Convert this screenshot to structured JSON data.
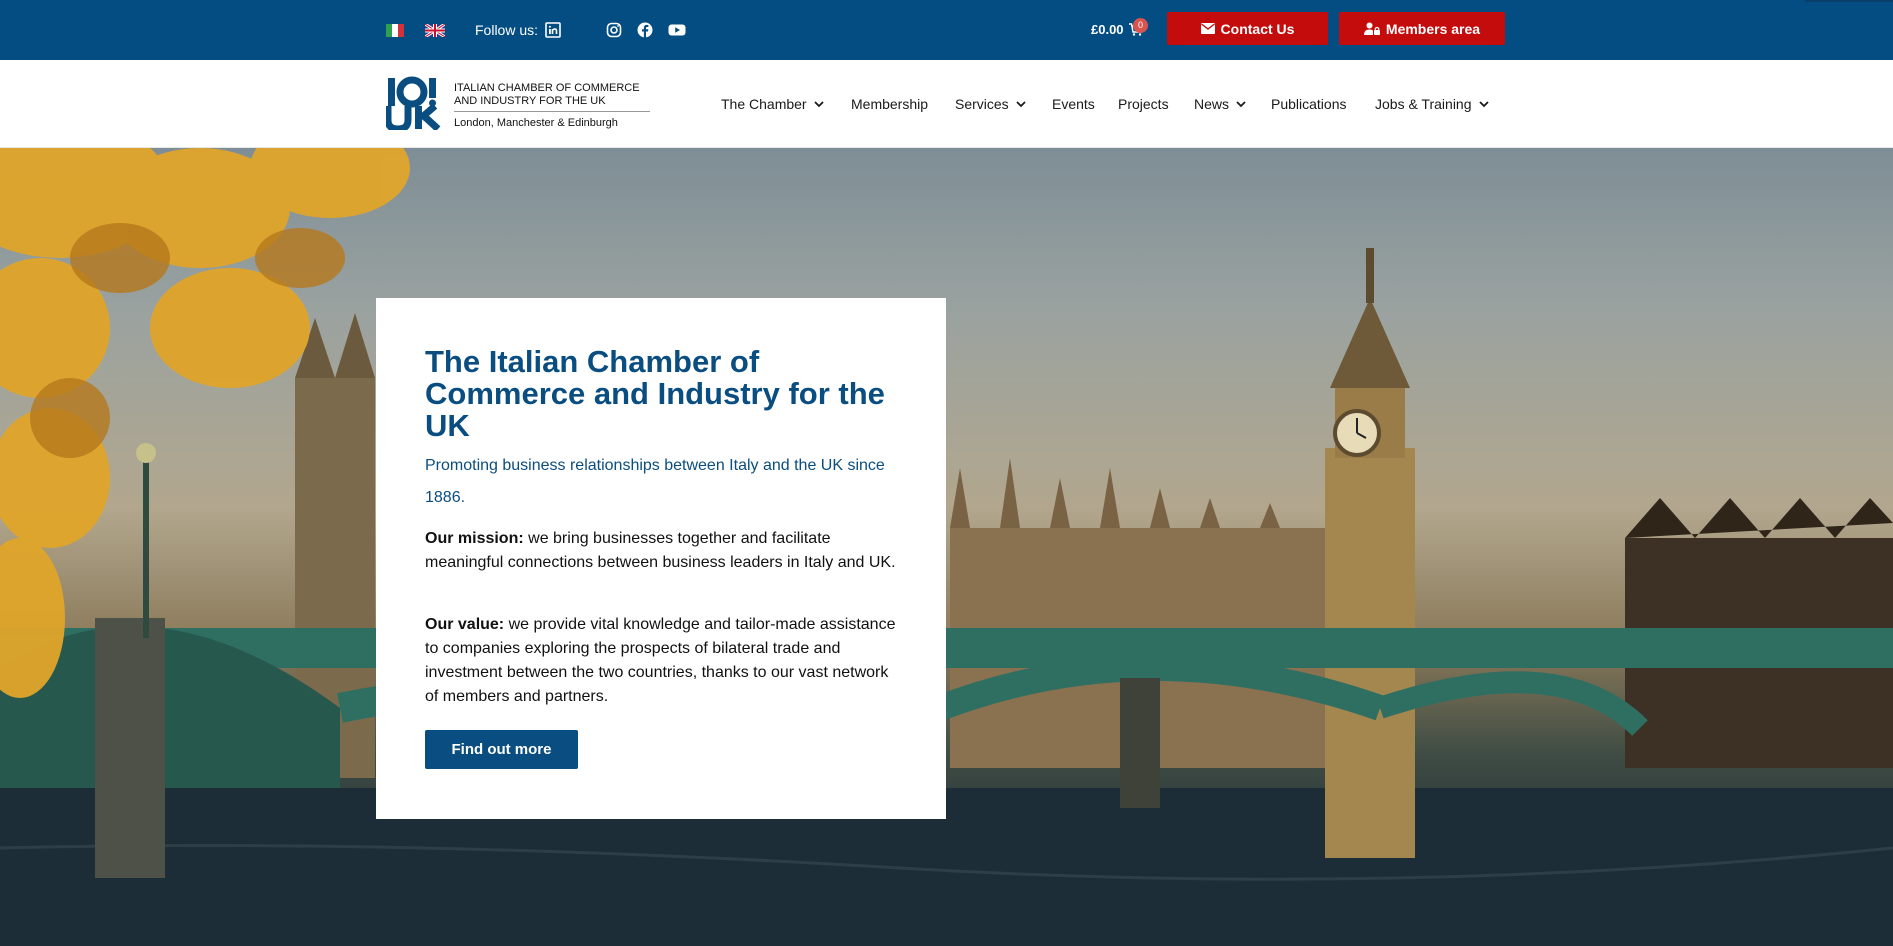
{
  "topbar": {
    "follow_label": "Follow us:",
    "cart_total": "£0.00",
    "cart_count": "0",
    "contact_label": "Contact Us",
    "members_label": "Members area"
  },
  "logo": {
    "line1": "ITALIAN CHAMBER OF COMMERCE",
    "line2": "AND INDUSTRY FOR THE UK",
    "line3": "London, Manchester & Edinburgh"
  },
  "nav": {
    "items": [
      {
        "label": "The Chamber",
        "dropdown": true
      },
      {
        "label": "Membership",
        "dropdown": false
      },
      {
        "label": "Services",
        "dropdown": true
      },
      {
        "label": "Events",
        "dropdown": false
      },
      {
        "label": "Projects",
        "dropdown": false
      },
      {
        "label": "News",
        "dropdown": true
      },
      {
        "label": "Publications",
        "dropdown": false
      },
      {
        "label": "Jobs & Training",
        "dropdown": true
      }
    ]
  },
  "hero": {
    "title": "The Italian Chamber of Commerce and Industry for the UK",
    "subtitle": "Promoting business relationships between Italy and the UK since 1886.",
    "mission_label": "Our mission:",
    "mission_text": " we bring businesses together and facilitate meaningful connections between business leaders in Italy and UK.",
    "value_label": "Our value:",
    "value_text": " we provide vital knowledge and tailor-made assistance to companies exploring the prospects of bilateral trade and investment between the two countries, thanks to our vast network of members and partners.",
    "cta_label": "Find out more"
  },
  "colors": {
    "brand_blue": "#044d82",
    "accent_red": "#c40c0c"
  },
  "icons": [
    "italian-flag-icon",
    "uk-flag-icon",
    "linkedin-icon",
    "instagram-icon",
    "facebook-icon",
    "youtube-icon",
    "cart-icon",
    "envelope-icon",
    "user-lock-icon",
    "chevron-down-icon"
  ]
}
